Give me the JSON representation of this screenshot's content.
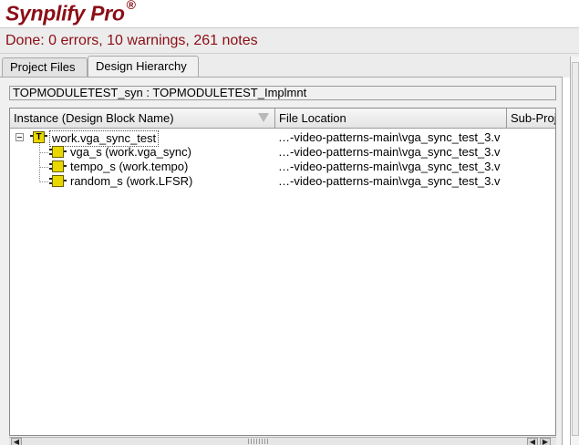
{
  "app": {
    "brand": "Synplify Pro",
    "registered_mark": "®"
  },
  "status": {
    "text": "Done:  0 errors, 10 warnings, 261 notes"
  },
  "tabs": [
    {
      "label": "Project Files",
      "active": false
    },
    {
      "label": "Design Hierarchy",
      "active": true
    }
  ],
  "implementation": {
    "value": "TOPMODULETEST_syn : TOPMODULETEST_Implmnt"
  },
  "table": {
    "columns": [
      "Instance (Design Block Name)",
      "File Location",
      "Sub-Proj"
    ],
    "rows": [
      {
        "name": "work.vga_sync_test",
        "location": "…-video-patterns-main\\vga_sync_test_3.v",
        "level": 0,
        "icon": "top-module-icon",
        "selected": true
      },
      {
        "name": "vga_s (work.vga_sync)",
        "location": "…-video-patterns-main\\vga_sync_test_3.v",
        "level": 1,
        "icon": "module-icon"
      },
      {
        "name": "tempo_s (work.tempo)",
        "location": "…-video-patterns-main\\vga_sync_test_3.v",
        "level": 1,
        "icon": "module-icon"
      },
      {
        "name": "random_s (work.LFSR)",
        "location": "…-video-patterns-main\\vga_sync_test_3.v",
        "level": 1,
        "icon": "module-icon"
      }
    ]
  },
  "icons": {
    "expander": "collapse-icon",
    "top_module_glyph": "T",
    "sort": "sort-indicator-icon",
    "scroll_left": "◀",
    "scroll_right": "▶"
  },
  "colors": {
    "brand": "#8b0e16",
    "status_text": "#8b0e16",
    "module_icon": "#e8d800"
  }
}
